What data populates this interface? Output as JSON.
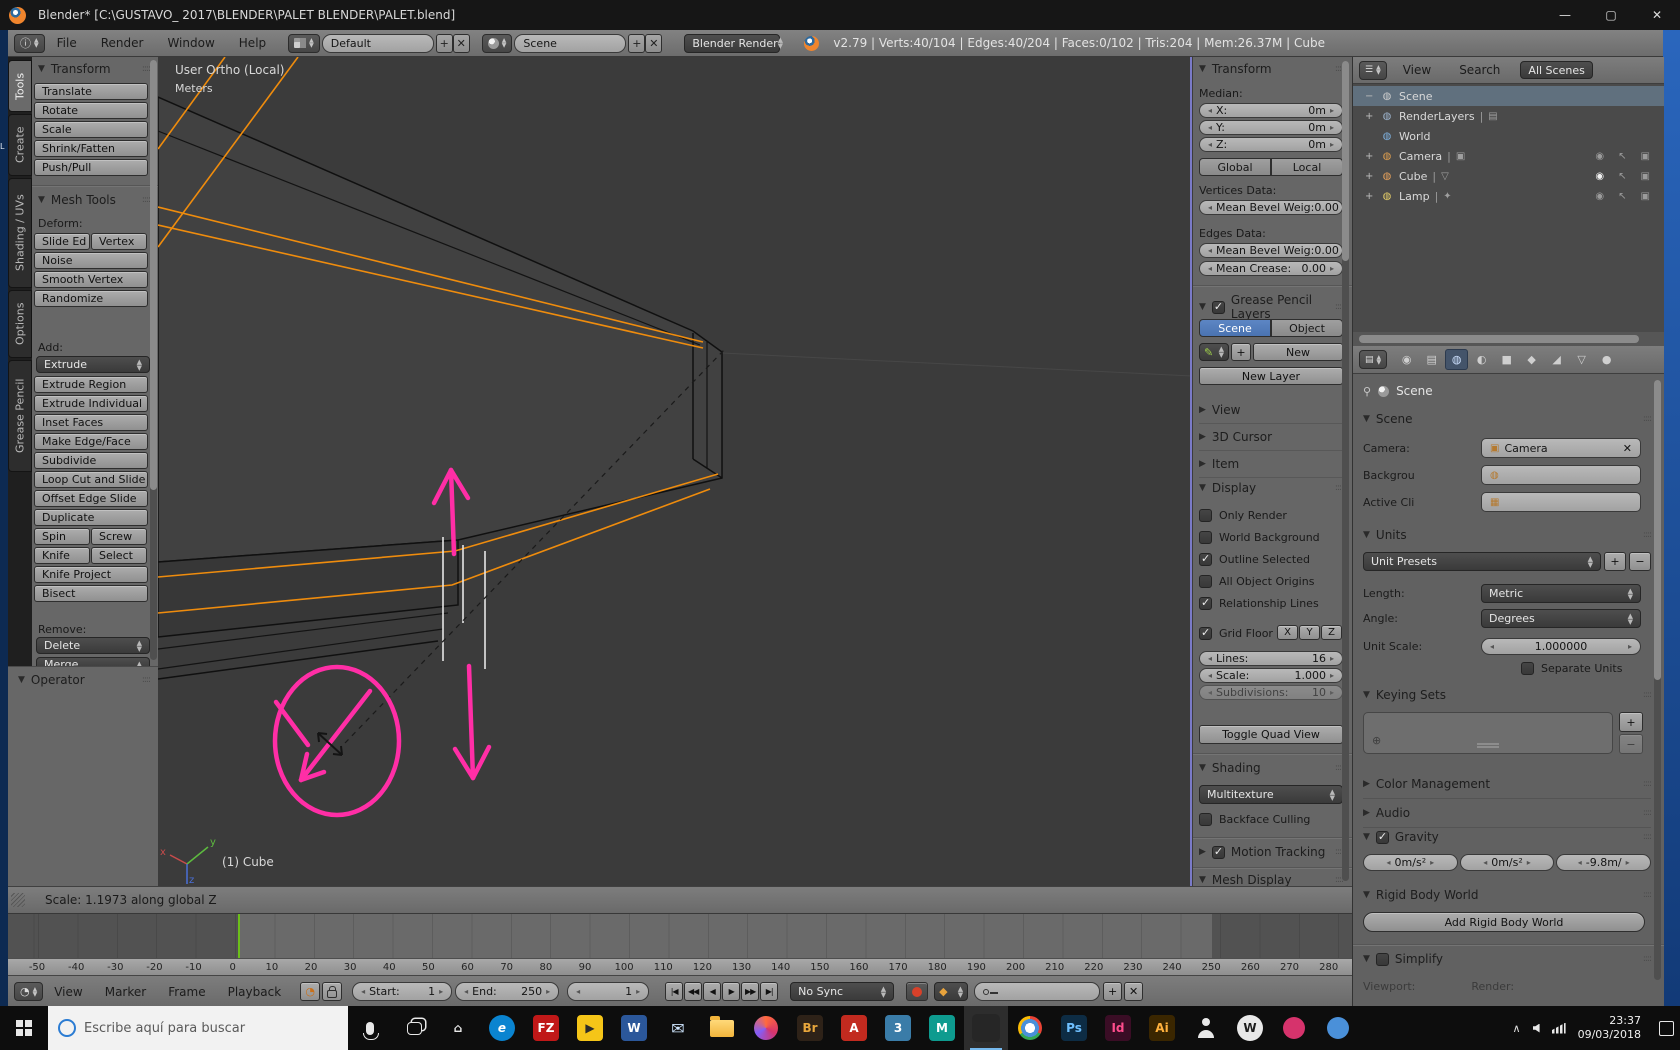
{
  "window": {
    "title": "Blender* [C:\\GUSTAVO_ 2017\\BLENDER\\PALET BLENDER\\PALET.blend]",
    "minimize": "—",
    "maximize": "▢",
    "close": "✕"
  },
  "desktop": {
    "icon_label": "L"
  },
  "header": {
    "menus": [
      "File",
      "Render",
      "Window",
      "Help"
    ],
    "layout_value": "Default",
    "scene_value": "Scene",
    "engine_value": "Blender Render",
    "add_label": "+",
    "close_label": "✕",
    "stats": "v2.79 | Verts:40/104 | Edges:40/204 | Faces:0/102 | Tris:204 | Mem:26.37M | Cube"
  },
  "tool_tabs": [
    {
      "label": "Tools",
      "cls": "active"
    },
    {
      "label": "Create"
    },
    {
      "label": "Shading / UVs"
    },
    {
      "label": "Options"
    },
    {
      "label": "Grease Pencil"
    }
  ],
  "toolshelf": {
    "transform_title": "Transform",
    "transform_buttons": [
      {
        "label": "Translate"
      },
      {
        "label": "Rotate"
      },
      {
        "label": "Scale"
      },
      {
        "label": "Shrink/Fatten"
      },
      {
        "label": "Push/Pull"
      }
    ],
    "mesh_tools_title": "Mesh Tools",
    "deform_label": "Deform:",
    "deform_buttons": [
      {
        "label": "Slide Ed",
        "cls": "half"
      },
      {
        "label": "Vertex",
        "cls": "half"
      },
      {
        "label": "Noise"
      },
      {
        "label": "Smooth Vertex"
      },
      {
        "label": "Randomize"
      }
    ],
    "add_label": "Add:",
    "extrude_menu": "Extrude",
    "add_buttons": [
      {
        "label": "Extrude Region"
      },
      {
        "label": "Extrude Individual"
      },
      {
        "label": "Inset Faces"
      },
      {
        "label": "Make Edge/Face"
      },
      {
        "label": "Subdivide"
      },
      {
        "label": "Loop Cut and Slide"
      },
      {
        "label": "Offset Edge Slide"
      },
      {
        "label": "Duplicate"
      },
      {
        "label": "Spin",
        "cls": "half"
      },
      {
        "label": "Screw",
        "cls": "half"
      },
      {
        "label": "Knife",
        "cls": "half"
      },
      {
        "label": "Select",
        "cls": "half"
      },
      {
        "label": "Knife Project"
      },
      {
        "label": "Bisect"
      }
    ],
    "remove_label": "Remove:",
    "delete_menu": "Delete",
    "merge_menu": "Merge",
    "operator_title": "Operator"
  },
  "viewport": {
    "view_label": "User Ortho (Local)",
    "grid_label": "Meters",
    "object_label": "(1) Cube",
    "axis_x": "x",
    "axis_y": "y",
    "axis_z": "z"
  },
  "statusbar": {
    "text": "Scale: 1.1973 along global Z"
  },
  "npanel": {
    "transform_title": "Transform",
    "median_label": "Median:",
    "median_fields": [
      {
        "label": "X:",
        "value": "0m"
      },
      {
        "label": "Y:",
        "value": "0m"
      },
      {
        "label": "Z:",
        "value": "0m"
      }
    ],
    "orient_buttons": [
      {
        "label": "Global"
      },
      {
        "label": "Local"
      }
    ],
    "vertices_label": "Vertices Data:",
    "vertices_fields": [
      {
        "label": "Mean Bevel Weig:",
        "value": "0.00"
      }
    ],
    "edges_label": "Edges Data:",
    "edges_fields": [
      {
        "label": "Mean Bevel Weig:",
        "value": "0.00"
      },
      {
        "label": "Mean Crease:",
        "value": "0.00"
      }
    ],
    "grease_title": "Grease Pencil Layers",
    "gp_tabs": [
      {
        "label": "Scene",
        "cls": "active"
      },
      {
        "label": "Object"
      }
    ],
    "gp_new": "New",
    "gp_new_layer": "New Layer",
    "collapsed_sections": [
      {
        "label": "View"
      },
      {
        "label": "3D Cursor"
      },
      {
        "label": "Item"
      }
    ],
    "display_title": "Display",
    "display_checks": [
      {
        "label": "Only Render"
      },
      {
        "label": "World Background"
      },
      {
        "label": "Outline Selected",
        "cls": "checked"
      },
      {
        "label": "All Object Origins"
      },
      {
        "label": "Relationship Lines",
        "cls": "checked"
      }
    ],
    "grid_floor_label": "Grid Floor",
    "axis_buttons": [
      {
        "label": "X"
      },
      {
        "label": "Y"
      },
      {
        "label": "Z"
      }
    ],
    "display_fields": [
      {
        "label": "Lines:",
        "value": "16"
      },
      {
        "label": "Scale:",
        "value": "1.000"
      },
      {
        "label": "Subdivisions:",
        "value": "10",
        "cls": "disabled"
      }
    ],
    "toggle_quad": "Toggle Quad View",
    "shading_title": "Shading",
    "shading_mode": "Multitexture",
    "backface_label": "Backface Culling",
    "motion_title": "Motion Tracking",
    "meshdisplay_title": "Mesh Display"
  },
  "outliner": {
    "view_menu": "View",
    "search_menu": "Search",
    "scenes_filter": "All Scenes",
    "rows": [
      {
        "expand": "−",
        "icon": "scene",
        "label": "Scene",
        "cls": "selected"
      },
      {
        "expand": "+",
        "icon": "layers",
        "label": "RenderLayers",
        "cls": "ex",
        "extra": "▤"
      },
      {
        "expand": "",
        "icon": "world",
        "label": "World",
        "cls": ""
      },
      {
        "expand": "+",
        "icon": "camera",
        "label": "Camera",
        "cls": "ex obj",
        "extra": "▣"
      },
      {
        "expand": "+",
        "icon": "mesh",
        "label": "Cube",
        "cls": "ex obj eyeopen",
        "extra": "▽"
      },
      {
        "expand": "+",
        "icon": "lamp",
        "label": "Lamp",
        "cls": "ex obj",
        "extra": "✦"
      }
    ]
  },
  "properties": {
    "tabs": [
      {
        "glyph": "◉",
        "cls": ""
      },
      {
        "glyph": "▤",
        "cls": ""
      },
      {
        "glyph": "◍",
        "cls": "active"
      },
      {
        "glyph": "◐",
        "cls": ""
      },
      {
        "glyph": "■",
        "cls": ""
      },
      {
        "glyph": "◆",
        "cls": ""
      },
      {
        "glyph": "◢",
        "cls": ""
      },
      {
        "glyph": "▽",
        "cls": ""
      },
      {
        "glyph": "●",
        "cls": ""
      }
    ],
    "breadcrumb": "Scene",
    "scene_title": "Scene",
    "scene_rows": [
      {
        "label": "Camera:",
        "value": "Camera",
        "cls": "hasx",
        "icon": "▣"
      },
      {
        "label": "Backgrou",
        "value": "",
        "cls": "",
        "icon": "◍"
      },
      {
        "label": "Active Cli",
        "value": "",
        "cls": "",
        "icon": "▦"
      }
    ],
    "clear_glyph": "✕",
    "units_title": "Units",
    "unit_presets": "Unit Presets",
    "unit_dropdowns": [
      {
        "label": "Length:",
        "value": "Metric"
      },
      {
        "label": "Angle:",
        "value": "Degrees"
      }
    ],
    "unit_scale_label": "Unit Scale:",
    "unit_scale_value": "1.000000",
    "separate_units": "Separate Units",
    "keying_title": "Keying Sets",
    "collapsed_sections": [
      {
        "label": "Color Management"
      },
      {
        "label": "Audio"
      }
    ],
    "gravity_title": "Gravity",
    "gravity_values": [
      {
        "value": "0m/s²"
      },
      {
        "value": "0m/s²"
      },
      {
        "value": "-9.8m/"
      }
    ],
    "rigid_title": "Rigid Body World",
    "rigid_button": "Add Rigid Body World",
    "simplify_title": "Simplify",
    "viewport_label": "Viewport:",
    "render_label": "Render:"
  },
  "timeline": {
    "ruler": [
      "-50",
      "-40",
      "-30",
      "-20",
      "-10",
      "0",
      "10",
      "20",
      "30",
      "40",
      "50",
      "60",
      "70",
      "80",
      "90",
      "100",
      "110",
      "120",
      "130",
      "140",
      "150",
      "160",
      "170",
      "180",
      "190",
      "200",
      "210",
      "220",
      "230",
      "240",
      "250",
      "260",
      "270",
      "280"
    ],
    "menus": [
      {
        "label": "View"
      },
      {
        "label": "Marker"
      },
      {
        "label": "Frame"
      },
      {
        "label": "Playback"
      }
    ],
    "start_label": "Start:",
    "start_value": "1",
    "end_label": "End:",
    "end_value": "250",
    "current_frame": "1",
    "transport": [
      {
        "g": "|◀"
      },
      {
        "g": "◀◀"
      },
      {
        "g": "◀"
      },
      {
        "g": "▶"
      },
      {
        "g": "▶▶"
      },
      {
        "g": "▶|"
      }
    ],
    "sync_mode": "No Sync"
  },
  "taskbar": {
    "search_placeholder": "Escribe aquí para buscar",
    "time": "23:37",
    "date": "09/03/2018",
    "tray_expand": "∧",
    "icons": [
      {
        "kind": "k-mic"
      },
      {
        "kind": "k-taskview"
      },
      {
        "kind": "k-app",
        "g": "⌂",
        "style": {
          "background": "transparent",
          "color": "#e8e8e8"
        }
      },
      {
        "kind": "k-app",
        "g": "e",
        "style": {
          "background": "#0a84d0",
          "color": "#ffffff",
          "borderRadius": "50%",
          "fontStyle": "italic"
        }
      },
      {
        "kind": "k-app",
        "g": "FZ",
        "style": {
          "background": "#c01818",
          "color": "#ffffff"
        }
      },
      {
        "kind": "k-app",
        "g": "▶",
        "style": {
          "background": "#f5c518",
          "color": "#2b2b2b"
        }
      },
      {
        "kind": "k-app",
        "g": "W",
        "style": {
          "background": "#2b579a",
          "color": "#ffffff"
        }
      },
      {
        "kind": "k-app",
        "g": "✉",
        "style": {
          "background": "transparent",
          "color": "#cfe6ff",
          "fontSize": "16px"
        }
      },
      {
        "kind": "k-folder"
      },
      {
        "kind": "k-media"
      },
      {
        "kind": "k-app",
        "g": "Br",
        "style": {
          "background": "#2e2218",
          "color": "#e8a63c"
        }
      },
      {
        "kind": "k-app",
        "g": "A",
        "style": {
          "background": "#c22a1f",
          "color": "#ffffff"
        }
      },
      {
        "kind": "k-app",
        "g": "3",
        "style": {
          "background": "#3a7ca8",
          "color": "#ffffff"
        }
      },
      {
        "kind": "k-app",
        "g": "M",
        "style": {
          "background": "#0e9b8f",
          "color": "#ffffff"
        }
      },
      {
        "kind": "k-blender",
        "cls": "active"
      },
      {
        "kind": "k-chrome"
      },
      {
        "kind": "k-app",
        "g": "Ps",
        "style": {
          "background": "#0d2c44",
          "color": "#6fc0ff"
        }
      },
      {
        "kind": "k-app",
        "g": "Id",
        "style": {
          "background": "#3a0d25",
          "color": "#ff4d8d"
        }
      },
      {
        "kind": "k-app",
        "g": "Ai",
        "style": {
          "background": "#3a2600",
          "color": "#ffb13d"
        }
      },
      {
        "kind": "k-person"
      },
      {
        "kind": "k-app",
        "g": "W",
        "style": {
          "background": "#e8e8e8",
          "color": "#1c1c1c",
          "borderRadius": "50%"
        }
      },
      {
        "kind": "k-dot",
        "style": {
          "background": "#d6336c"
        }
      },
      {
        "kind": "k-dot",
        "style": {
          "background": "#4a90d9"
        }
      }
    ]
  }
}
